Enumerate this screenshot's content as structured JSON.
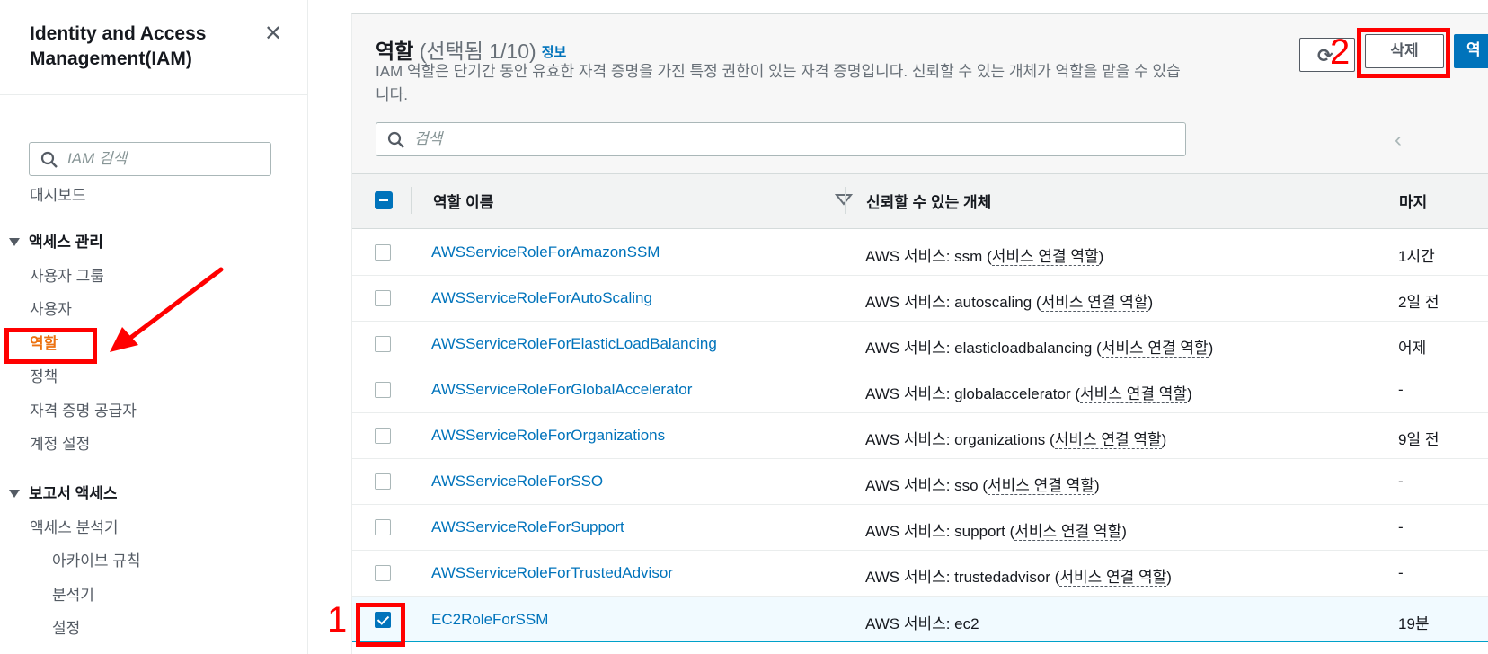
{
  "sidebar": {
    "title": "Identity and Access Management(IAM)",
    "search_placeholder": "IAM 검색",
    "dashboard": "대시보드",
    "section_access": "액세스 관리",
    "access_items": [
      "사용자 그룹",
      "사용자",
      "역할",
      "정책",
      "자격 증명 공급자",
      "계정 설정"
    ],
    "section_reports": "보고서 액세스",
    "analyzer": "액세스 분석기",
    "analyzer_items": [
      "아카이브 규칙",
      "분석기",
      "설정"
    ]
  },
  "header": {
    "title": "역할",
    "count": "(선택됨 1/10)",
    "info": "정보",
    "description": "IAM 역할은 단기간 동안 유효한 자격 증명을 가진 특정 권한이 있는 자격 증명입니다. 신뢰할 수 있는 개체가 역할을 맡을 수 있습니다.",
    "search_placeholder": "검색",
    "delete_label": "삭제",
    "create_label": "역"
  },
  "annotations": {
    "step1": "1",
    "step2": "2"
  },
  "table": {
    "columns": [
      "역할 이름",
      "신뢰할 수 있는 개체",
      "마지"
    ],
    "rows": [
      {
        "name": "AWSServiceRoleForAmazonSSM",
        "trust_prefix": "AWS 서비스: ssm (",
        "trust_link": "서비스 연결 역할",
        "trust_suffix": ")",
        "last": "1시간",
        "checked": false
      },
      {
        "name": "AWSServiceRoleForAutoScaling",
        "trust_prefix": "AWS 서비스: autoscaling (",
        "trust_link": "서비스 연결 역할",
        "trust_suffix": ")",
        "last": "2일 전",
        "checked": false
      },
      {
        "name": "AWSServiceRoleForElasticLoadBalancing",
        "trust_prefix": "AWS 서비스: elasticloadbalancing (",
        "trust_link": "서비스 연결 역할",
        "trust_suffix": ")",
        "last": "어제",
        "checked": false
      },
      {
        "name": "AWSServiceRoleForGlobalAccelerator",
        "trust_prefix": "AWS 서비스: globalaccelerator (",
        "trust_link": "서비스 연결 역할",
        "trust_suffix": ")",
        "last": "-",
        "checked": false
      },
      {
        "name": "AWSServiceRoleForOrganizations",
        "trust_prefix": "AWS 서비스: organizations (",
        "trust_link": "서비스 연결 역할",
        "trust_suffix": ")",
        "last": "9일 전",
        "checked": false
      },
      {
        "name": "AWSServiceRoleForSSO",
        "trust_prefix": "AWS 서비스: sso (",
        "trust_link": "서비스 연결 역할",
        "trust_suffix": ")",
        "last": "-",
        "checked": false
      },
      {
        "name": "AWSServiceRoleForSupport",
        "trust_prefix": "AWS 서비스: support (",
        "trust_link": "서비스 연결 역할",
        "trust_suffix": ")",
        "last": "-",
        "checked": false
      },
      {
        "name": "AWSServiceRoleForTrustedAdvisor",
        "trust_prefix": "AWS 서비스: trustedadvisor (",
        "trust_link": "서비스 연결 역할",
        "trust_suffix": ")",
        "last": "-",
        "checked": false
      },
      {
        "name": "EC2RoleForSSM",
        "trust_prefix": "AWS 서비스: ec2",
        "trust_link": "",
        "trust_suffix": "",
        "last": "19분",
        "checked": true
      }
    ]
  }
}
